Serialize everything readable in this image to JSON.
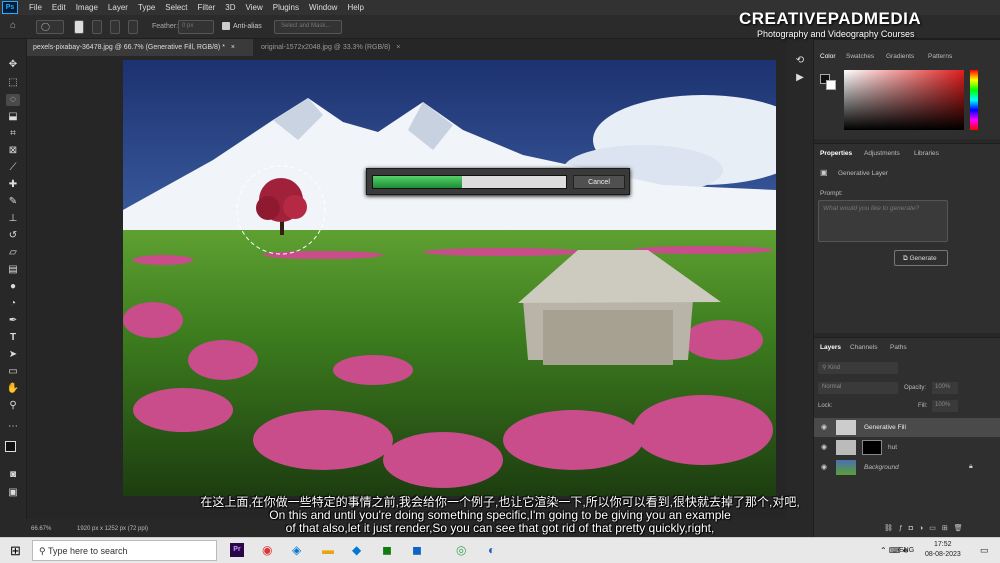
{
  "menu": {
    "app_icon": "Ps",
    "items": [
      "File",
      "Edit",
      "Image",
      "Layer",
      "Type",
      "Select",
      "Filter",
      "3D",
      "View",
      "Plugins",
      "Window",
      "Help"
    ]
  },
  "options": {
    "feather_label": "Feather:",
    "feather_value": "0 px",
    "antialias_label": "Anti-alias",
    "select_mask_label": "Select and Mask..."
  },
  "tabs": [
    {
      "label": "pexels-pixabay-36478.jpg @ 66.7% (Generative Fill, RGB/8) *",
      "close": "×"
    },
    {
      "label": "original-1572x2048.jpg @ 33.3% (RGB/8)",
      "close": "×"
    }
  ],
  "watermark": {
    "brand": "CREATIVEPADMEDIA",
    "tagline": "Photography and Videography Courses"
  },
  "progress": {
    "fraction": 0.46,
    "cancel_label": "Cancel",
    "fill_color": "#2db34a"
  },
  "status": {
    "zoom": "66.67%",
    "doc_info": "1920 px x 1252 px (72 ppi)"
  },
  "color_panel": {
    "tabs": [
      "Color",
      "Swatches",
      "Gradients",
      "Patterns"
    ]
  },
  "properties": {
    "tabs": [
      "Properties",
      "Adjustments",
      "Libraries"
    ],
    "layer_type": "Generative Layer",
    "prompt_label": "Prompt:",
    "prompt_placeholder": "What would you like to generate?",
    "generate_label": "Generate"
  },
  "layers_panel": {
    "tabs": [
      "Layers",
      "Channels",
      "Paths"
    ],
    "kind_placeholder": "Kind",
    "blend_mode": "Normal",
    "opacity_label": "Opacity:",
    "opacity_value": "100%",
    "lock_label": "Lock:",
    "fill_label": "Fill:",
    "fill_value": "100%",
    "layers": [
      {
        "name": "Generative Fill",
        "selected": true
      },
      {
        "name": "hut",
        "selected": false
      },
      {
        "name": "Background",
        "selected": false
      }
    ]
  },
  "subtitles": {
    "zh": "在这上面,在你做一些特定的事情之前,我会给你一个例子,也让它渲染一下,所以你可以看到,很快就去掉了那个,对吧,",
    "en1": "On this and until you're doing something specific,I'm going to be giving you an example",
    "en2": "of that also,let it just render,So you can see that got rid of that pretty quickly,right,"
  },
  "taskbar": {
    "search_placeholder": "Type here to search",
    "language": "ENG",
    "time": "17:52",
    "date": "08-08-2023"
  },
  "colors": {
    "accent": "#31a8ff",
    "progress_fill": "#2db34a"
  }
}
